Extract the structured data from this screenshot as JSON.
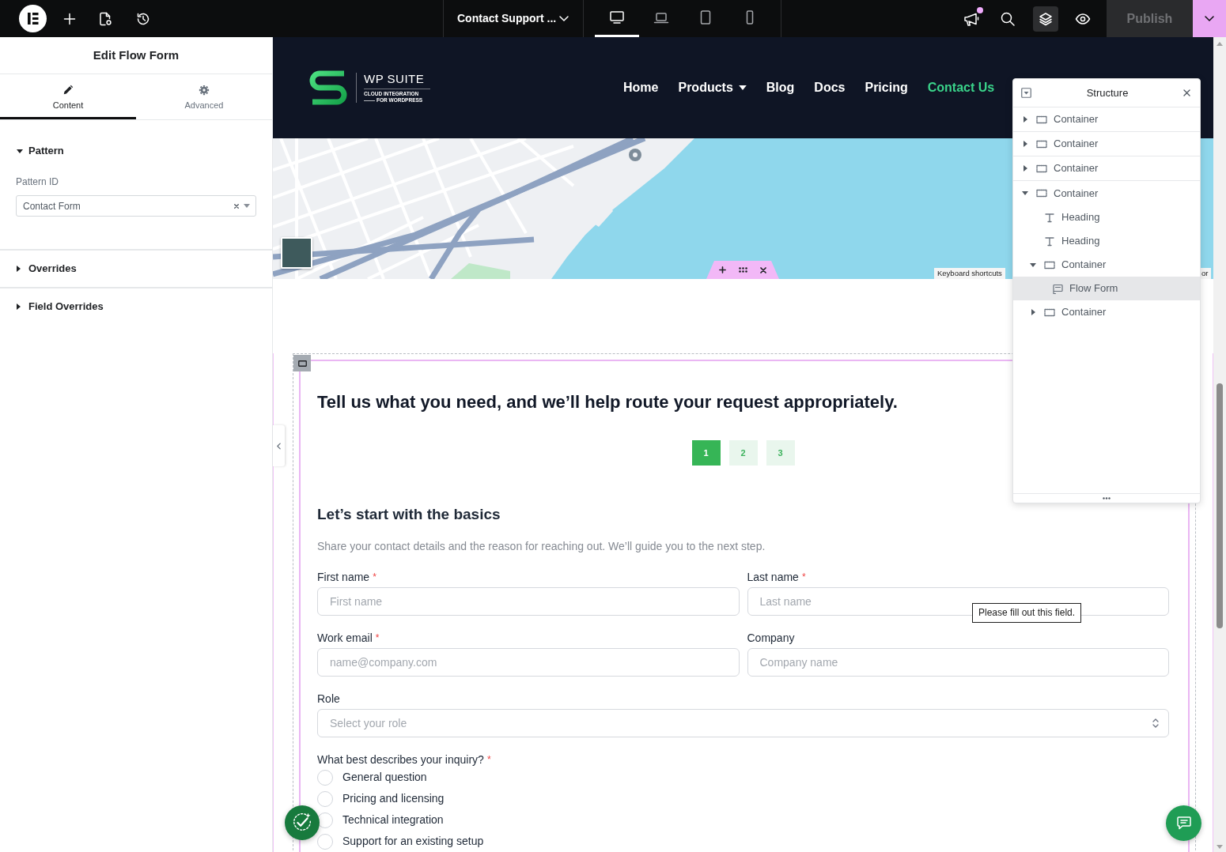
{
  "editor_bar": {
    "document_title": "Contact Support ...",
    "devices": [
      {
        "kind": "desktop",
        "selected": true
      },
      {
        "kind": "laptop",
        "selected": false
      },
      {
        "kind": "tablet",
        "selected": false
      },
      {
        "kind": "mobile",
        "selected": false
      }
    ],
    "notification": true,
    "structure_active": true,
    "publish": {
      "label": "Publish",
      "disabled": true
    }
  },
  "panel": {
    "title": "Edit Flow Form",
    "tabs": [
      {
        "kind": "content",
        "label": "Content",
        "selected": true
      },
      {
        "kind": "advanced",
        "label": "Advanced",
        "selected": false
      }
    ],
    "sections": [
      {
        "title": "Pattern",
        "expanded": true,
        "fields": [
          {
            "label": "Pattern ID",
            "value": "Contact Form"
          }
        ]
      },
      {
        "title": "Overrides",
        "expanded": false
      },
      {
        "title": "Field Overrides",
        "expanded": false
      }
    ]
  },
  "site_header": {
    "logo": {
      "name": "WP SUITE",
      "tagline": "CLOUD INTEGRATION",
      "tagline_2": "FOR WORDPRESS"
    },
    "nav": [
      {
        "label": "Home",
        "selected": false
      },
      {
        "label": "Products",
        "selected": false,
        "has_menu": true
      },
      {
        "label": "Blog",
        "selected": false
      },
      {
        "label": "Docs",
        "selected": false
      },
      {
        "label": "Pricing",
        "selected": false
      },
      {
        "label": "Contact Us",
        "selected": true
      }
    ]
  },
  "map": {
    "keyboard_shortcuts": "Keyboard shortcuts",
    "attribution": "or"
  },
  "form": {
    "heading": "Tell us what you need, and we’ll help route your request appropriately.",
    "steps": [
      {
        "label": "1",
        "selected": true
      },
      {
        "label": "2",
        "selected": false
      },
      {
        "label": "3",
        "selected": false
      }
    ],
    "title": "Let’s start with the basics",
    "description": "Share your contact details and the reason for reaching out. We’ll guide you to the next step.",
    "fields": [
      {
        "kind": "text",
        "label": "First name",
        "required_mark": "*",
        "placeholder": "First name"
      },
      {
        "kind": "text",
        "label": "Last name",
        "required_mark": "*",
        "placeholder": "Last name"
      },
      {
        "kind": "text",
        "label": "Work email",
        "required_mark": "*",
        "placeholder": "name@company.com"
      },
      {
        "kind": "text",
        "label": "Company",
        "placeholder": "Company name"
      },
      {
        "kind": "select",
        "label": "Role",
        "placeholder": "Select your role"
      }
    ],
    "inquiry": {
      "label": "What best describes your inquiry?",
      "required_mark": "*",
      "options": [
        {
          "label": "General question",
          "selected": false
        },
        {
          "label": "Pricing and licensing",
          "selected": false
        },
        {
          "label": "Technical integration",
          "selected": false
        },
        {
          "label": "Support for an existing setup",
          "selected": false
        }
      ]
    }
  },
  "tooltip": {
    "text": "Please fill out this field."
  },
  "structure": {
    "title": "Structure",
    "items": [
      {
        "kind": "container",
        "label": "Container",
        "expanded": false,
        "selected": false
      },
      {
        "kind": "container",
        "label": "Container",
        "expanded": false,
        "selected": false
      },
      {
        "kind": "container",
        "label": "Container",
        "expanded": false,
        "selected": false
      },
      {
        "kind": "container",
        "label": "Container",
        "expanded": true,
        "selected": false,
        "children": [
          {
            "kind": "heading",
            "label": "Heading",
            "selected": false
          },
          {
            "kind": "heading",
            "label": "Heading",
            "selected": false
          },
          {
            "kind": "container",
            "label": "Container",
            "expanded": true,
            "selected": false,
            "children": [
              {
                "kind": "form",
                "label": "Flow Form",
                "selected": true
              }
            ]
          },
          {
            "kind": "container",
            "label": "Container",
            "expanded": false,
            "selected": false
          }
        ]
      }
    ]
  }
}
